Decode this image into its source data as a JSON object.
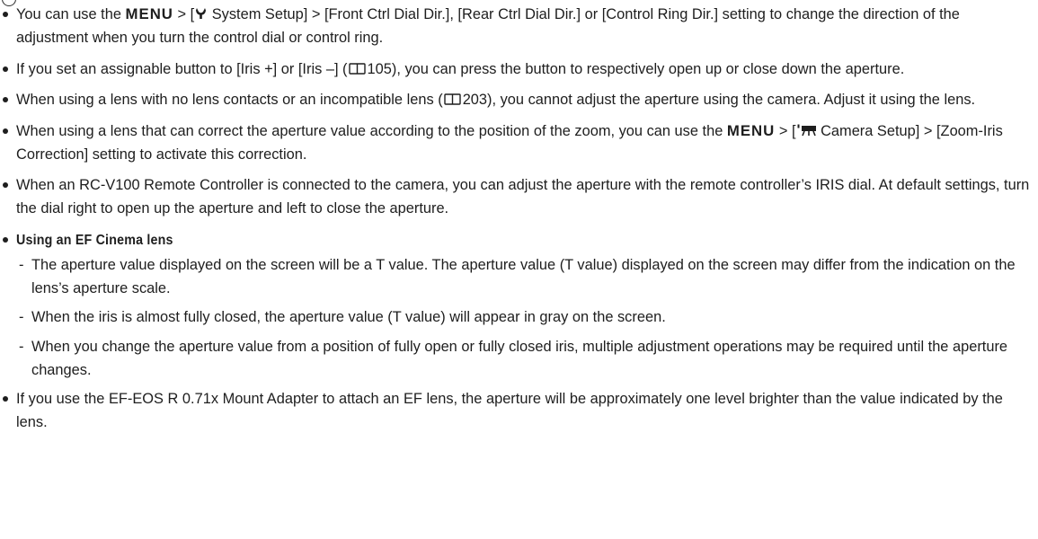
{
  "notes": [
    {
      "pre": "You can use the ",
      "menu": "MENU",
      "mid1": " > [",
      "icon_tool": "ƒ",
      "mid2": " System Setup] > [Front Ctrl Dial Dir.], [Rear Ctrl Dial Dir.] or [Control Ring Dir.] setting to change the direction of the adjustment when you turn the control dial or control ring."
    },
    {
      "pre": "If you set an assignable button to [Iris +] or [Iris –] (",
      "ref": "105",
      "post": "), you can press the button to respectively open up or close down the aperture."
    },
    {
      "pre": "When using a lens with no lens contacts or an incompatible lens (",
      "ref": "203",
      "post": "), you cannot adjust the aperture using the camera. Adjust it using the lens."
    },
    {
      "pre": "When using a lens that can correct the aperture value according to the position of the zoom, you can use the ",
      "menu": "MENU",
      "mid1": " > [",
      "mid2": " Camera Setup] > [Zoom-Iris Correction] setting to activate this correction."
    },
    {
      "text": "When an RC-V100 Remote Controller is connected to the camera, you can adjust the aperture with the remote controller’s IRIS dial. At default settings, turn the dial right to open up the aperture and left to close the aperture."
    },
    {
      "heading": "Using an EF Cinema lens",
      "subs": [
        "The aperture value displayed on the screen will be a T value. The aperture value (T value) displayed on the screen may differ from the indication on the lens’s aperture scale.",
        "When the iris is almost fully closed, the aperture value (T value) will appear in gray on the screen.",
        "When you change the aperture value from a position of fully open or fully closed iris, multiple adjustment operations may be required until the aperture changes."
      ]
    },
    {
      "text": "If you use the EF-EOS R 0.71x Mount Adapter to attach an EF lens, the aperture will be approximately one level brighter than the value indicated by the lens."
    }
  ],
  "sub_dash": "-",
  "icons": {
    "tool": "wrench-icon",
    "camera": "camera-setup-icon",
    "reference": "book-reference-icon"
  }
}
